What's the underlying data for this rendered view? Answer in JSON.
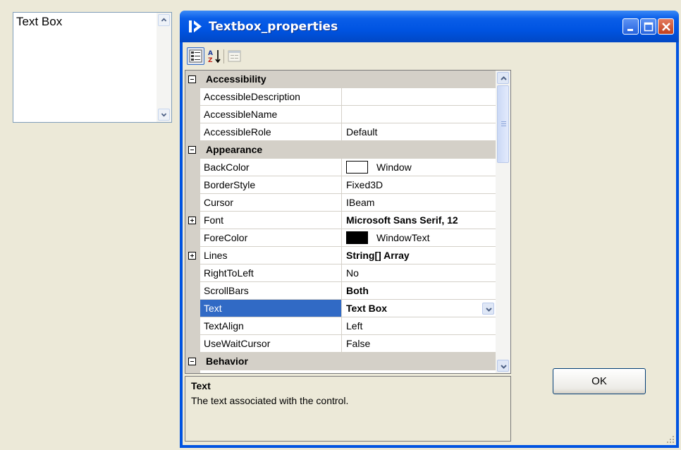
{
  "textbox_preview": {
    "text": "Text Box"
  },
  "window": {
    "title": "Textbox_properties",
    "ok_label": "OK"
  },
  "toolbar": {
    "buttons": [
      "categorized-icon",
      "alphabetical-icon",
      "property-pages-icon"
    ]
  },
  "property_grid": {
    "rows": [
      {
        "kind": "category",
        "label": "Accessibility",
        "expander": "minus"
      },
      {
        "kind": "prop",
        "name": "AccessibleDescription",
        "value": ""
      },
      {
        "kind": "prop",
        "name": "AccessibleName",
        "value": ""
      },
      {
        "kind": "prop",
        "name": "AccessibleRole",
        "value": "Default"
      },
      {
        "kind": "category",
        "label": "Appearance",
        "expander": "minus"
      },
      {
        "kind": "prop",
        "name": "BackColor",
        "value": "Window",
        "swatch": "#ffffff"
      },
      {
        "kind": "prop",
        "name": "BorderStyle",
        "value": "Fixed3D"
      },
      {
        "kind": "prop",
        "name": "Cursor",
        "value": "IBeam"
      },
      {
        "kind": "prop",
        "name": "Font",
        "value": "Microsoft Sans Serif, 12",
        "bold": true,
        "expander": "plus"
      },
      {
        "kind": "prop",
        "name": "ForeColor",
        "value": "WindowText",
        "swatch": "#000000"
      },
      {
        "kind": "prop",
        "name": "Lines",
        "value": "String[] Array",
        "bold": true,
        "expander": "plus"
      },
      {
        "kind": "prop",
        "name": "RightToLeft",
        "value": "No"
      },
      {
        "kind": "prop",
        "name": "ScrollBars",
        "value": "Both",
        "bold": true
      },
      {
        "kind": "prop",
        "name": "Text",
        "value": "Text Box",
        "bold": true,
        "selected": true,
        "dropdown": true
      },
      {
        "kind": "prop",
        "name": "TextAlign",
        "value": "Left"
      },
      {
        "kind": "prop",
        "name": "UseWaitCursor",
        "value": "False"
      },
      {
        "kind": "category",
        "label": "Behavior",
        "expander": "minus"
      }
    ]
  },
  "description": {
    "title": "Text",
    "text": "The text associated with the control."
  },
  "colors": {
    "selection": "#316ac5",
    "category_bg": "#d4d0c8",
    "titlebar": "#0054e2"
  }
}
